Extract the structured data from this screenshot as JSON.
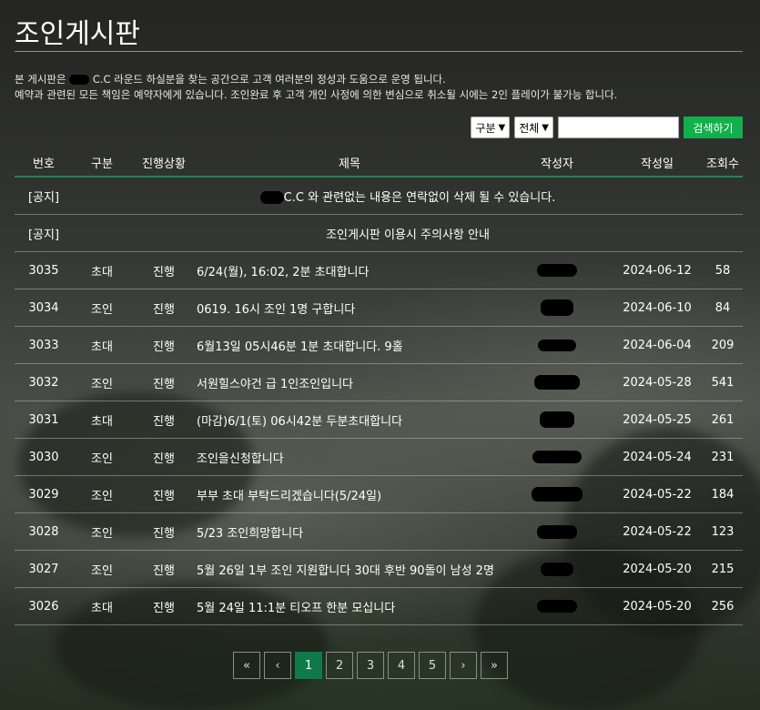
{
  "page": {
    "title": "조인게시판"
  },
  "notice": {
    "line1_before": "본 게시판은",
    "line1_after": "C.C 라운드 하실분을 찾는 공간으로 고객 여러분의 정성과 도움으로 운영 됩니다.",
    "line2": "예약과 관련된 모든 책임은 예약자에게 있습니다. 조인완료 후 고객 개인 사정에 의한 변심으로 취소될 시에는 2인 플레이가 불가능 합니다."
  },
  "search": {
    "category_select": "구분",
    "status_select": "전체",
    "keyword": "",
    "button_label": "검색하기"
  },
  "table": {
    "headers": [
      "번호",
      "구분",
      "진행상황",
      "제목",
      "작성자",
      "작성일",
      "조회수"
    ],
    "notices": [
      {
        "tag": "[공지]",
        "title": "C.C 와 관련없는 내용은 연락없이 삭제 될 수 있습니다.",
        "has_redaction": true
      },
      {
        "tag": "[공지]",
        "title": "조인게시판 이용시 주의사항 안내",
        "has_redaction": false
      }
    ],
    "rows": [
      {
        "num": "3035",
        "cat": "초대",
        "status": "진행",
        "title": "6/24(월), 16:02, 2분 초대합니다",
        "date": "2024-06-12",
        "views": "58"
      },
      {
        "num": "3034",
        "cat": "조인",
        "status": "진행",
        "title": "0619. 16시 조인 1명 구합니다",
        "date": "2024-06-10",
        "views": "84"
      },
      {
        "num": "3033",
        "cat": "초대",
        "status": "진행",
        "title": "6월13일 05시46분 1분 초대합니다. 9홀",
        "date": "2024-06-04",
        "views": "209"
      },
      {
        "num": "3032",
        "cat": "조인",
        "status": "진행",
        "title": "서원힐스야건 급 1인조인입니다",
        "date": "2024-05-28",
        "views": "541"
      },
      {
        "num": "3031",
        "cat": "초대",
        "status": "진행",
        "title": "(마감)6/1(토) 06시42분 두분초대합니다",
        "date": "2024-05-25",
        "views": "261"
      },
      {
        "num": "3030",
        "cat": "조인",
        "status": "진행",
        "title": "조인을신청합니다",
        "date": "2024-05-24",
        "views": "231"
      },
      {
        "num": "3029",
        "cat": "조인",
        "status": "진행",
        "title": "부부 초대 부탁드리겠습니다(5/24일)",
        "date": "2024-05-22",
        "views": "184"
      },
      {
        "num": "3028",
        "cat": "조인",
        "status": "진행",
        "title": "5/23 조인희망합니다",
        "date": "2024-05-22",
        "views": "123"
      },
      {
        "num": "3027",
        "cat": "조인",
        "status": "진행",
        "title": "5월 26일 1부 조인 지원합니다 30대 후반 90돌이 남성 2명",
        "date": "2024-05-20",
        "views": "215"
      },
      {
        "num": "3026",
        "cat": "초대",
        "status": "진행",
        "title": "5월 24일 11:1분 티오프 한분 모십니다",
        "date": "2024-05-20",
        "views": "256"
      }
    ]
  },
  "pagination": {
    "first": "«",
    "prev": "‹",
    "pages": [
      "1",
      "2",
      "3",
      "4",
      "5"
    ],
    "active": "1",
    "next": "›",
    "last": "»"
  }
}
